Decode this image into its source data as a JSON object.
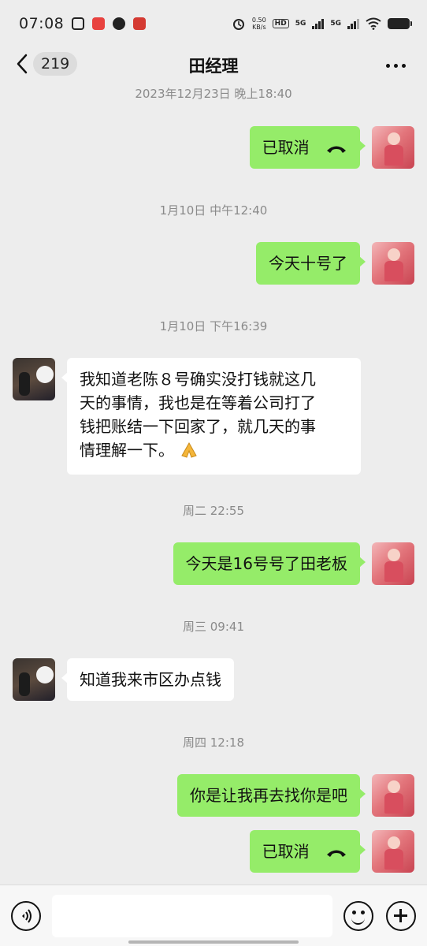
{
  "status_bar": {
    "time": "07:08",
    "net_speed_value": "0.50",
    "net_speed_unit": "KB/s",
    "hd_tag": "HD",
    "sim1_tag": "5G",
    "sim2_tag": "5G",
    "icons": [
      "video-app-icon",
      "app-icon",
      "message-icon",
      "app-icon",
      "alarm-icon",
      "hd-voice-icon",
      "signal-icon",
      "wifi-icon",
      "battery-icon"
    ]
  },
  "header": {
    "back_icon": "chevron-left-icon",
    "unread_count": "219",
    "title": "田经理",
    "more_icon": "more-dots-icon"
  },
  "messages": {
    "ts0": "2023年12月23日 晚上18:40",
    "m1": "已取消",
    "ts1": "1月10日 中午12:40",
    "m2": "今天十号了",
    "ts2": "1月10日 下午16:39",
    "m3_line1": "我知道老陈８号确实没打钱就这几",
    "m3_line2": "天的事情，我也是在等着公司打了",
    "m3_line3": "钱把账结一下回家了，就几天的事",
    "m3_line4": "情理解一下。",
    "ts3": "周二 22:55",
    "m4": "今天是16号号了田老板",
    "ts4": "周三 09:41",
    "m5": "知道我来市区办点钱",
    "ts5": "周四 12:18",
    "m6": "你是让我再去找你是吧",
    "m7": "已取消"
  },
  "input_bar": {
    "voice_icon": "voice-icon",
    "emoji_icon": "emoji-icon",
    "plus_icon": "plus-icon",
    "placeholder": ""
  },
  "colors": {
    "background": "#ededed",
    "my_bubble": "#95ec69",
    "other_bubble": "#ffffff",
    "timestamp": "#8a8a8a"
  }
}
